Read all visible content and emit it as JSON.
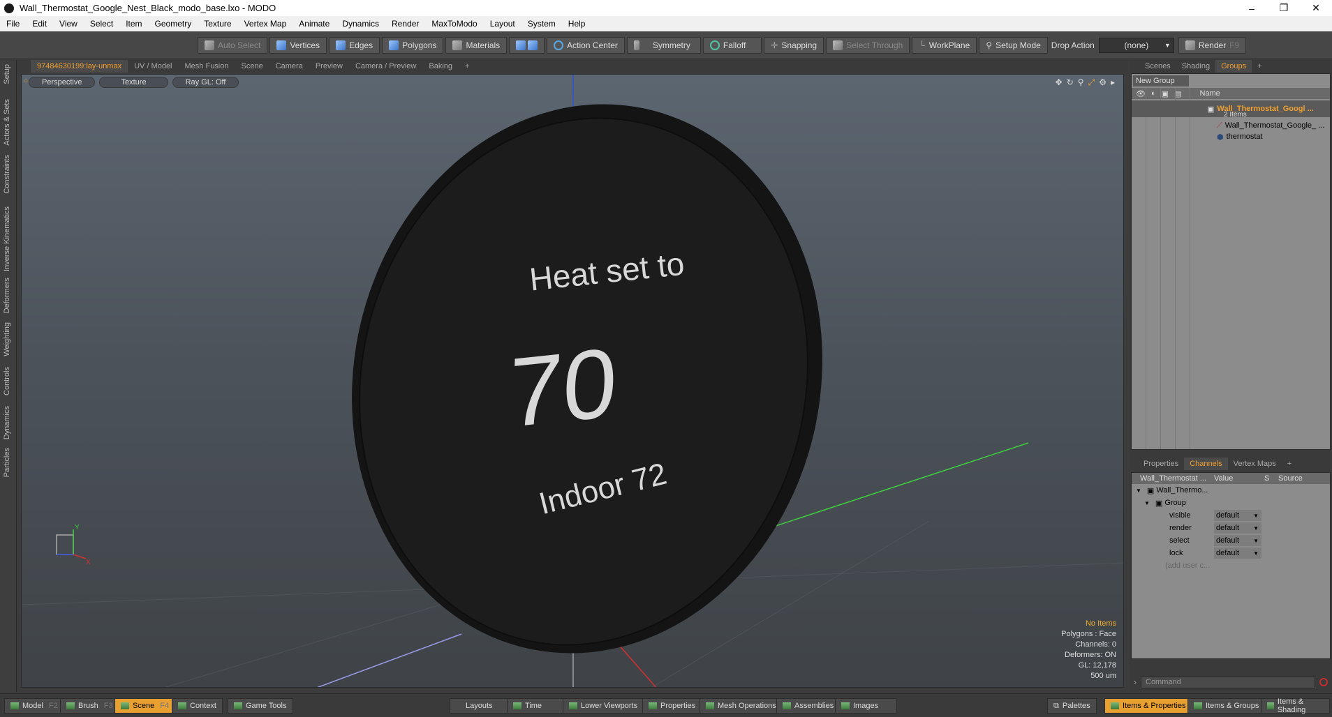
{
  "window": {
    "title": "Wall_Thermostat_Google_Nest_Black_modo_base.lxo - MODO",
    "minimize": "–",
    "restore": "❐",
    "close": "✕"
  },
  "menu": [
    "File",
    "Edit",
    "View",
    "Select",
    "Item",
    "Geometry",
    "Texture",
    "Vertex Map",
    "Animate",
    "Dynamics",
    "Render",
    "MaxToModo",
    "Layout",
    "System",
    "Help"
  ],
  "toolbar": {
    "auto_select": "Auto Select",
    "vertices": "Vertices",
    "edges": "Edges",
    "polygons": "Polygons",
    "materials": "Materials",
    "action_center": "Action Center",
    "symmetry": "Symmetry",
    "falloff": "Falloff",
    "snapping": "Snapping",
    "select_through": "Select Through",
    "workplane": "WorkPlane",
    "setup_mode": "Setup Mode",
    "drop_action": "Drop Action",
    "drop_value": "(none)",
    "render": "Render",
    "render_key": "F9"
  },
  "left_tabs": [
    "Setup",
    "Actors & Sets",
    "Constraints",
    "Inverse Kinematics",
    "Deformers",
    "Weighting",
    "Controls",
    "Dynamics",
    "Particles"
  ],
  "viewport_tabs": [
    "97484630199:lay-unmax",
    "UV / Model",
    "Mesh Fusion",
    "Scene",
    "Camera",
    "Preview",
    "Camera / Preview",
    "Baking",
    "+"
  ],
  "viewport": {
    "view_mode": "Perspective",
    "shading": "Texture",
    "raygl": "Ray GL: Off",
    "screen": {
      "line1": "Heat set to",
      "line2": "70",
      "line3": "Indoor 72"
    },
    "axis_y": "Y",
    "axis_x": "X",
    "hud": [
      "No Items",
      "Polygons : Face",
      "Channels: 0",
      "Deformers: ON",
      "GL: 12,178",
      "500 um"
    ]
  },
  "right_top_tabs": [
    "Scenes",
    "Shading",
    "Groups",
    "+"
  ],
  "groups": {
    "new_group": "New Group",
    "name_header": "Name",
    "root_name": "Wall_Thermostat_Googl ...",
    "root_count": "2 Items",
    "children": [
      "Wall_Thermostat_Google_ ...",
      "thermostat"
    ]
  },
  "right_bottom_tabs": [
    "Properties",
    "Channels",
    "Vertex Maps",
    "+"
  ],
  "channels": {
    "header_name": "Wall_Thermostat ...",
    "header_value": "Value",
    "header_s": "S",
    "header_source": "Source",
    "item": "Wall_Thermo...",
    "group": "Group",
    "rows": [
      {
        "name": "visible",
        "value": "default"
      },
      {
        "name": "render",
        "value": "default"
      },
      {
        "name": "select",
        "value": "default"
      },
      {
        "name": "lock",
        "value": "default"
      }
    ],
    "add_user": "(add user c..."
  },
  "command_placeholder": "Command",
  "status": {
    "model": "Model",
    "model_key": "F2",
    "brush": "Brush",
    "brush_key": "F3",
    "scene": "Scene",
    "scene_key": "F4",
    "context": "Context",
    "game_tools": "Game Tools",
    "layouts": "Layouts",
    "time": "Time",
    "lower_viewports": "Lower Viewports",
    "properties": "Properties",
    "mesh_operations": "Mesh Operations",
    "assemblies": "Assemblies",
    "images": "Images",
    "palettes": "Palettes",
    "items_properties": "Items & Properties",
    "items_groups": "Items & Groups",
    "items_shading": "Items & Shading"
  },
  "colors": {
    "accent": "#f0a030",
    "y_axis": "#3ecf3e",
    "x_axis": "#d23030",
    "z_axis": "#3050d8"
  }
}
